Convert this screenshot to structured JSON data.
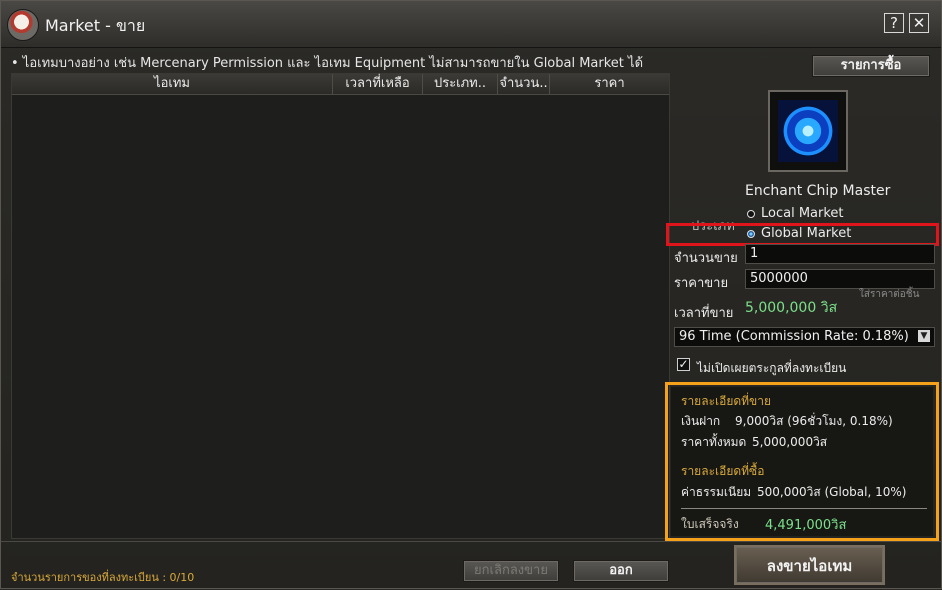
{
  "window": {
    "title": "Market - ขาย",
    "help_label": "?",
    "close_label": "✕"
  },
  "notice": "• ไอเทมบางอย่าง เช่น Mercenary Permission และ ไอเทม Equipment ไม่สามารถขายใน Global Market ได้",
  "buy_list_button": "รายการซื้อ",
  "table": {
    "columns": [
      "ไอเทม",
      "เวลาที่เหลือ",
      "ประเภท..",
      "จำนวน..",
      "ราคา"
    ],
    "rows": []
  },
  "item": {
    "name": "Enchant Chip Master",
    "icon": "enchant-chip-icon"
  },
  "form": {
    "type_label": "ประเภท",
    "market_options": [
      "Local Market",
      "Global Market"
    ],
    "selected_market": "Global Market",
    "quantity_label": "จำนวนขาย",
    "quantity_value": "1",
    "price_label": "ราคาขาย",
    "price_value": "5000000",
    "price_hint": "ใส่ราคาต่อชิ้น",
    "time_label": "เวลาที่ขาย",
    "total_price": "5,000,000 วิส",
    "duration_option": "96 Time (Commission Rate: 0.18%)",
    "hide_clan_label": "ไม่เปิดเผยตระกูลที่ลงทะเบียน",
    "hide_clan_checked": true
  },
  "details": {
    "sell_title": "รายละเอียดที่ขาย",
    "deposit_label": "เงินฝาก",
    "deposit_value": "9,000วิส (96ชั่วโมง, 0.18%)",
    "total_label": "ราคาทั้งหมด",
    "total_value": "5,000,000วิส",
    "buy_title": "รายละเอียดที่ซื้อ",
    "fee_label": "ค่าธรรมเนียม",
    "fee_value": "500,000วิส (Global, 10%)",
    "receipt_label": "ใบเสร็จจริง",
    "receipt_value": "4,491,000วิส"
  },
  "footer": {
    "registered_count": "จำนวนรายการของที่ลงทะเบียน : 0/10",
    "cancel_button": "ยกเลิกลงขาย",
    "exit_button": "ออก",
    "sell_button": "ลงขายไอเทม"
  },
  "colors": {
    "highlight_red": "#e0141b",
    "highlight_orange": "#f5a21a",
    "money_green": "#7be08a",
    "section_gold": "#d9a93a"
  }
}
